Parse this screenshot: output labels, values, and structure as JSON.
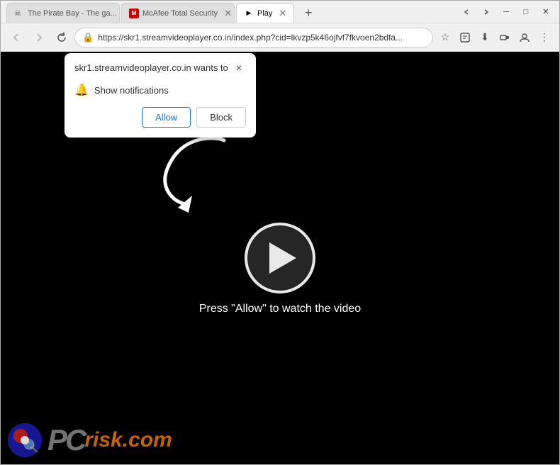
{
  "window": {
    "title": "Play"
  },
  "titlebar": {
    "tabs": [
      {
        "id": "tab-piratebay",
        "label": "The Pirate Bay - The ga...",
        "favicon": "pirate",
        "active": false
      },
      {
        "id": "tab-mcafee",
        "label": "McAfee Total Security",
        "favicon": "mcafee",
        "active": false
      },
      {
        "id": "tab-play",
        "label": "Play",
        "favicon": "play",
        "active": true
      }
    ],
    "new_tab_label": "+",
    "minimize": "─",
    "maximize": "□",
    "close": "✕"
  },
  "navbar": {
    "back_title": "Back",
    "forward_title": "Forward",
    "refresh_title": "Refresh",
    "address": "https://skr1.streamvideoplayer.co.in/index.php?cid=lkvzp5k46ojfvf7fkvoen2bdfa...",
    "star_title": "Bookmark",
    "download_title": "Download",
    "account_title": "Account",
    "menu_title": "Menu"
  },
  "popup": {
    "title": "skr1.streamvideoplayer.co.in wants to",
    "permission_label": "Show notifications",
    "allow_label": "Allow",
    "block_label": "Block",
    "close_label": "×"
  },
  "content": {
    "press_allow_text": "Press \"Allow\" to watch the video"
  },
  "watermark": {
    "pc_text": "PC",
    "risk_text": "risk.com"
  }
}
